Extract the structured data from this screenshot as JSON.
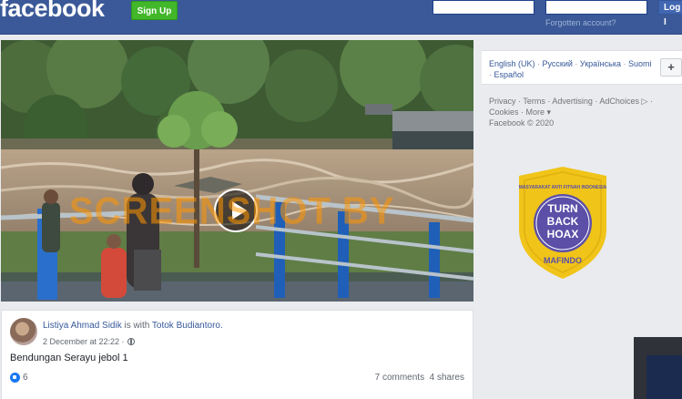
{
  "header": {
    "logo_text": "facebook",
    "signup_label": "Sign Up",
    "login_label": "Log I",
    "forgot_label": "Forgotten account?",
    "brand_color": "#3b5998"
  },
  "video": {
    "play_icon": "play-icon"
  },
  "watermark": {
    "text": "SCREENSHOT BY"
  },
  "badge": {
    "top_text": "MASYARAKAT ANTI FITNAH INDONESIA",
    "line1": "TURN",
    "line2": "BACK",
    "line3": "HOAX",
    "bottom_text": "MAFINDO",
    "color": "#f0c419"
  },
  "post": {
    "author": "Listiya Ahmad Sidik",
    "with_text": "is with",
    "tagged": "Totok Budiantoro.",
    "date": "2 December at 22:22 ·",
    "text": "Bendungan Serayu jebol 1",
    "likes": "6",
    "comments": "7 comments",
    "shares": "4 shares"
  },
  "sidebar": {
    "languages": [
      "English (UK)",
      "Русский",
      "Українська",
      "Suomi",
      "Español"
    ],
    "add_language": "+",
    "footer_links": [
      "Privacy",
      "Terms",
      "Advertising",
      "AdChoices",
      "Cookies",
      "More"
    ],
    "copyright": "Facebook © 2020"
  }
}
